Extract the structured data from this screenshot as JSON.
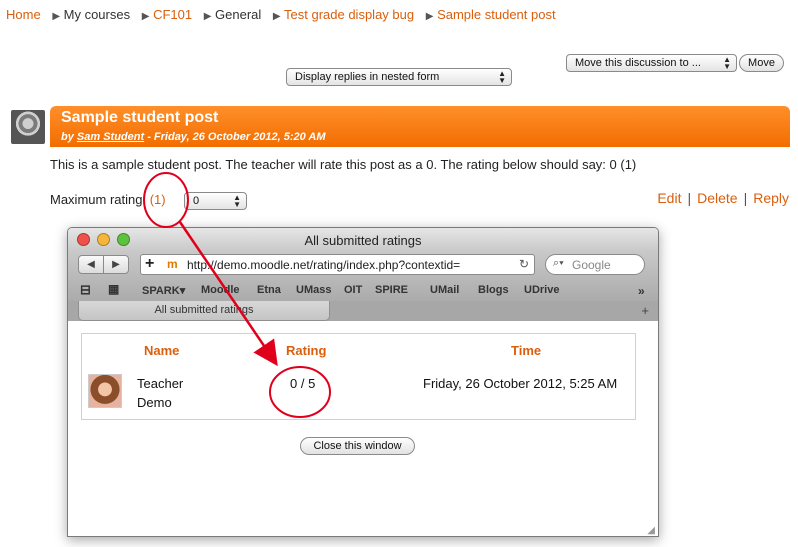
{
  "breadcrumb": {
    "home": "Home",
    "my_courses": "My courses",
    "course": "CF101",
    "section": "General",
    "forum": "Test grade display bug",
    "post": "Sample student post"
  },
  "controls": {
    "display_mode": "Display replies in nested form",
    "move_select": "Move this discussion to ...",
    "move_button": "Move"
  },
  "post": {
    "title": "Sample student post",
    "by": "by",
    "author": "Sam Student",
    "date": " - Friday, 26 October 2012, 5:20 AM",
    "body": "This is a sample student post. The teacher will rate this post as a 0. The rating below should say: 0 (1)",
    "rating_label": "Maximum rating:",
    "rating_count": "(1)",
    "rating_select": "0",
    "actions": {
      "edit": "Edit",
      "delete": "Delete",
      "reply": "Reply"
    }
  },
  "popup": {
    "window_title": "All submitted ratings",
    "url": "http://demo.moodle.net/rating/index.php?contextid=",
    "search_placeholder": "Google",
    "bookmarks": [
      "SPARK▾",
      "Moodle",
      "Etna",
      "UMass",
      "OIT",
      "SPIRE",
      "UMail",
      "Blogs",
      "UDrive"
    ],
    "tab_label": "All submitted ratings",
    "table": {
      "headers": {
        "name": "Name",
        "rating": "Rating",
        "time": "Time"
      },
      "row": {
        "name_first": "Teacher",
        "name_last": "Demo",
        "rating": "0 / 5",
        "time": "Friday, 26 October 2012, 5:25 AM"
      }
    },
    "close_button": "Close this window"
  },
  "colors": {
    "accent": "#d95f0e",
    "header_orange": "#f57c16",
    "annotation_red": "#e0001b"
  }
}
